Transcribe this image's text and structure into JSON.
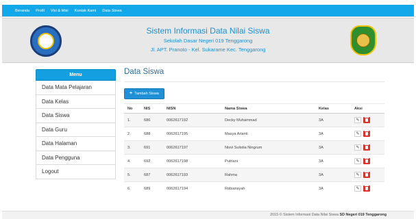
{
  "nav": {
    "items": [
      "Beranda",
      "Profil",
      "Visi & Misi",
      "Kontak Kami",
      "Data Siswa"
    ]
  },
  "header": {
    "title": "Sistem Informasi Data Nilai Siswa",
    "school": "Sekolah Dasar Negeri 019 Tenggarong",
    "address": "Jl. APT. Pranoto - Kel. Sukarame Kec. Tenggarong",
    "logo_left_icon": "tut-wuri-handayani-logo",
    "logo_right_icon": "kutai-kartanegara-emblem"
  },
  "sidebar": {
    "heading": "Menu",
    "items": [
      "Data Mata Pelajaran",
      "Data Kelas",
      "Data Siswa",
      "Data Guru",
      "Data Halaman",
      "Data Pengguna",
      "Logout"
    ]
  },
  "main": {
    "title": "Data Siswa",
    "add_button": "Tambah Siswa",
    "columns": [
      "No",
      "NIS",
      "NISN",
      "Nama Siswa",
      "Kelas",
      "Aksi"
    ],
    "rows": [
      [
        "1.",
        "686",
        "0062617192",
        "Decky Muhammad",
        "3A"
      ],
      [
        "2.",
        "688",
        "0062617195",
        "Masya Arianti",
        "3A"
      ],
      [
        "3.",
        "691",
        "0062617197",
        "Nisvi Sulistia Ningrum",
        "3A"
      ],
      [
        "4.",
        "692",
        "0062617198",
        "Putriani",
        "3A"
      ],
      [
        "5.",
        "687",
        "0062617193",
        "Rahma",
        "3A"
      ],
      [
        "6.",
        "689",
        "0062617194",
        "Robiansyah",
        "3A"
      ]
    ]
  },
  "footer": {
    "text": "2015 © Sistem Informasi Data Nilai Siswa",
    "bold": "SD Negeri 019 Tenggarong"
  },
  "colors": {
    "accent": "#13a8e9",
    "delete": "#d9342b",
    "title_blue": "#1e8fd0"
  }
}
